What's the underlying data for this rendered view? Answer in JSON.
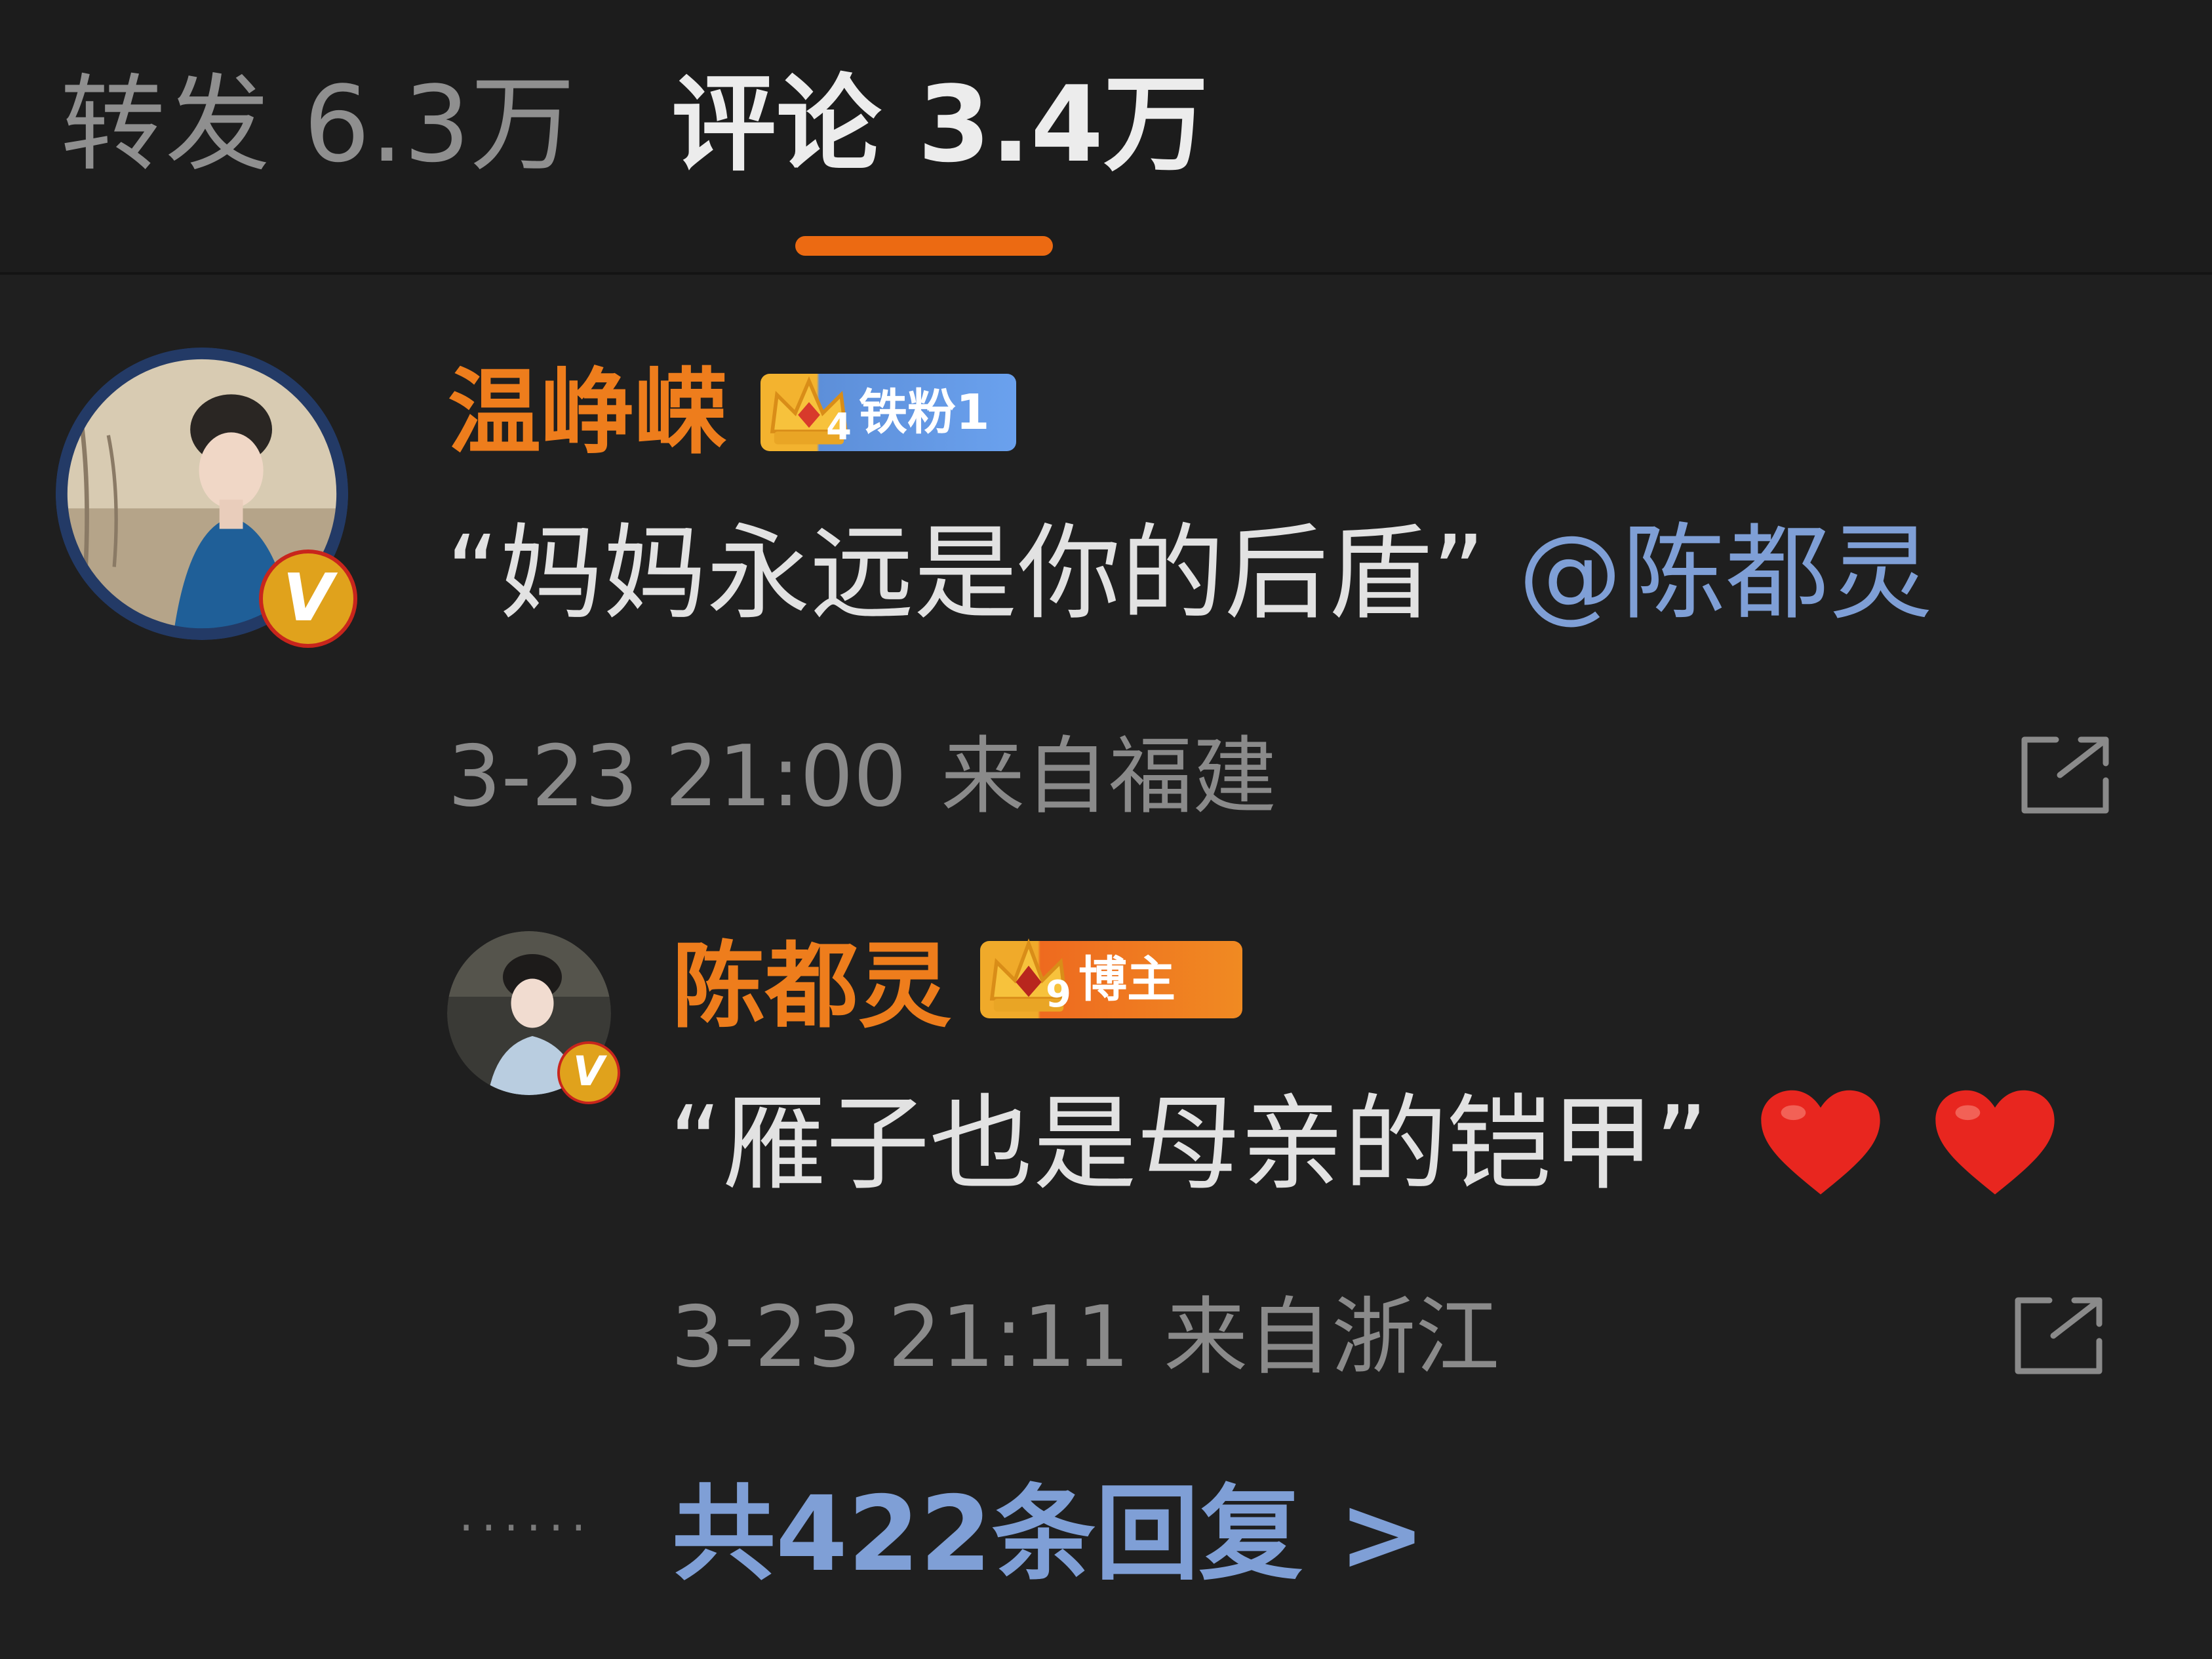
{
  "tabs": {
    "repost": "转发 6.3万",
    "comments": "评论 3.4万",
    "active_color": "#ec6a12"
  },
  "comment": {
    "username": "温峥嵘",
    "fan_badge": {
      "level": "4",
      "label": "铁粉1"
    },
    "text": "“妈妈永远是你的后盾”",
    "mention": "@陈都灵",
    "date": "3-23 21:00",
    "location": "来自福建",
    "share_icon": "share-icon",
    "verified_icon": "verified-v-icon"
  },
  "reply": {
    "username": "陈都灵",
    "blogger_badge": {
      "level": "9",
      "label": "博主"
    },
    "text": "“雁子也是母亲的铠甲”",
    "emoji": [
      "heart-icon",
      "heart-icon"
    ],
    "date": "3-23 21:11",
    "location": "来自浙江",
    "share_icon": "share-icon",
    "verified_icon": "verified-v-icon"
  },
  "replies_more": {
    "dots": "······",
    "label": "共422条回复 >"
  },
  "colors": {
    "background": "#1f1f1f",
    "username": "#ee7d1c",
    "mention_link": "#7f9fd6",
    "meta": "#8a8a8a"
  }
}
